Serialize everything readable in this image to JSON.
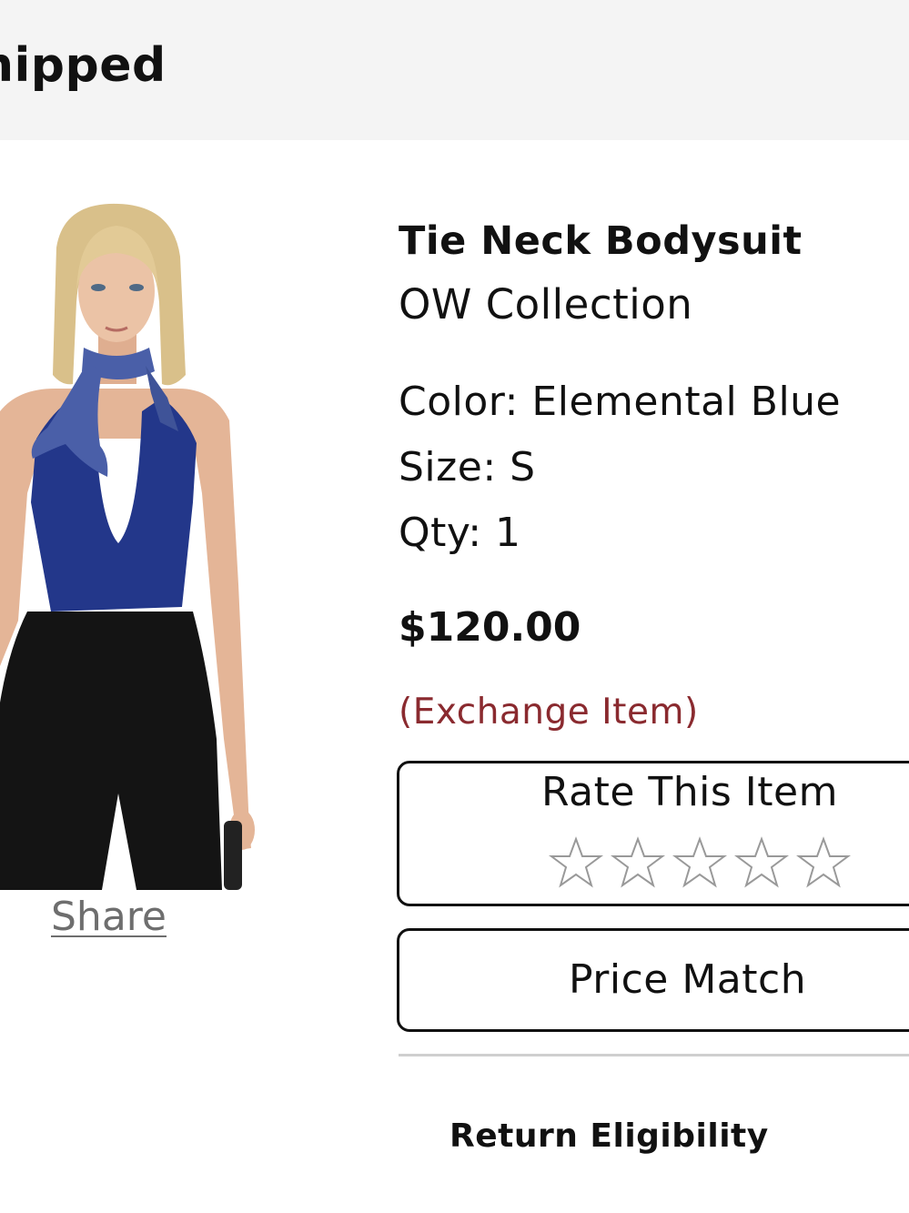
{
  "status": {
    "text": "Shipped"
  },
  "product": {
    "name": "Tie Neck Bodysuit",
    "brand": "OW Collection",
    "color": "Color: Elemental Blue",
    "size": "Size: S",
    "qty": "Qty: 1",
    "price": "$120.00",
    "exchange_note": "(Exchange Item)",
    "image_icon": "product-photo"
  },
  "actions": {
    "share_label": "Share",
    "rate_title": "Rate This Item",
    "rating": {
      "value": 0,
      "max": 5
    },
    "price_match_label": "Price Match",
    "return_eligibility_label": "Return Eligibility"
  },
  "colors": {
    "exchange_note": "#8a2a2f",
    "banner_bg": "#f4f4f4",
    "bodysuit": "#23378a",
    "scarf": "#4a5fa8",
    "pants": "#111111"
  }
}
